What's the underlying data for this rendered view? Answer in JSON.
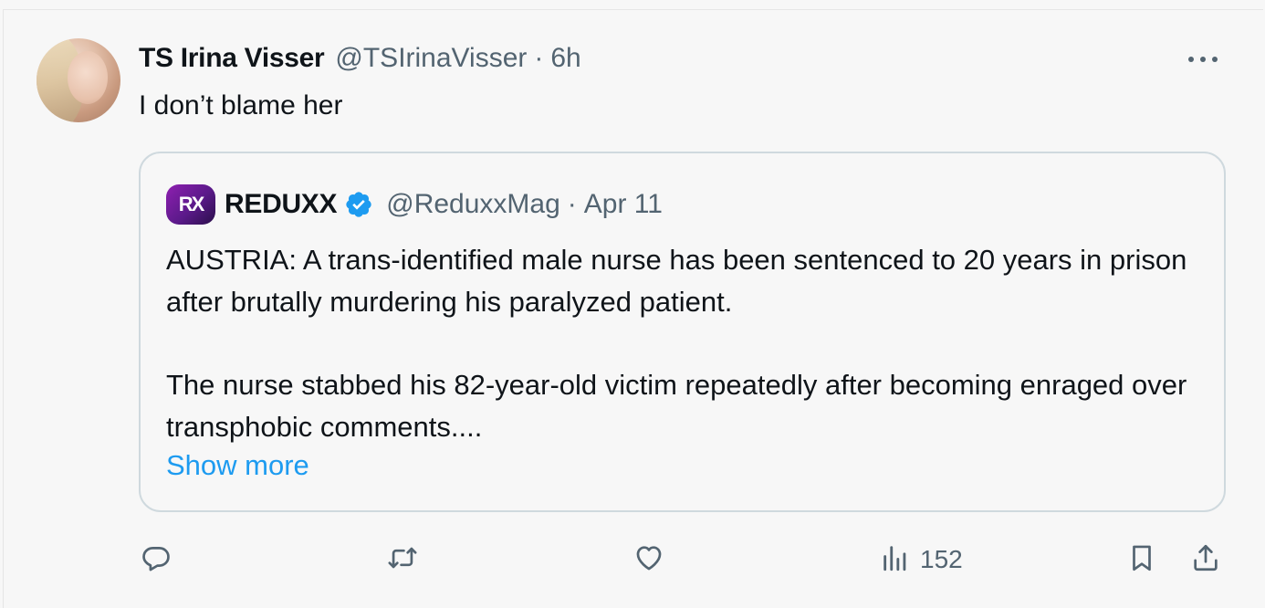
{
  "post": {
    "author_name": "TS Irina Visser",
    "author_handle": "@TSIrinaVisser",
    "separator": "·",
    "time": "6h",
    "text": "I don’t blame her"
  },
  "quoted": {
    "avatar_text": "RX",
    "author_name": "REDUXX",
    "verified": true,
    "author_handle": "@ReduxxMag",
    "separator": "·",
    "date": "Apr 11",
    "paragraph1": "AUSTRIA: A trans-identified male nurse has been sentenced to 20 years in prison after brutally murdering his paralyzed patient.",
    "paragraph2": "The nurse stabbed his 82-year-old victim repeatedly after becoming enraged over transphobic comments....",
    "show_more": "Show more"
  },
  "actions": {
    "reply_icon": "reply-icon",
    "retweet_icon": "retweet-icon",
    "like_icon": "heart-icon",
    "views_icon": "views-icon",
    "views_count": "152",
    "bookmark_icon": "bookmark-icon",
    "share_icon": "share-icon"
  },
  "colors": {
    "text": "#0f1419",
    "secondary": "#536471",
    "link": "#1d9bf0",
    "verified": "#1d9bf0",
    "border": "#cfd9de",
    "background": "#f7f7f7"
  }
}
